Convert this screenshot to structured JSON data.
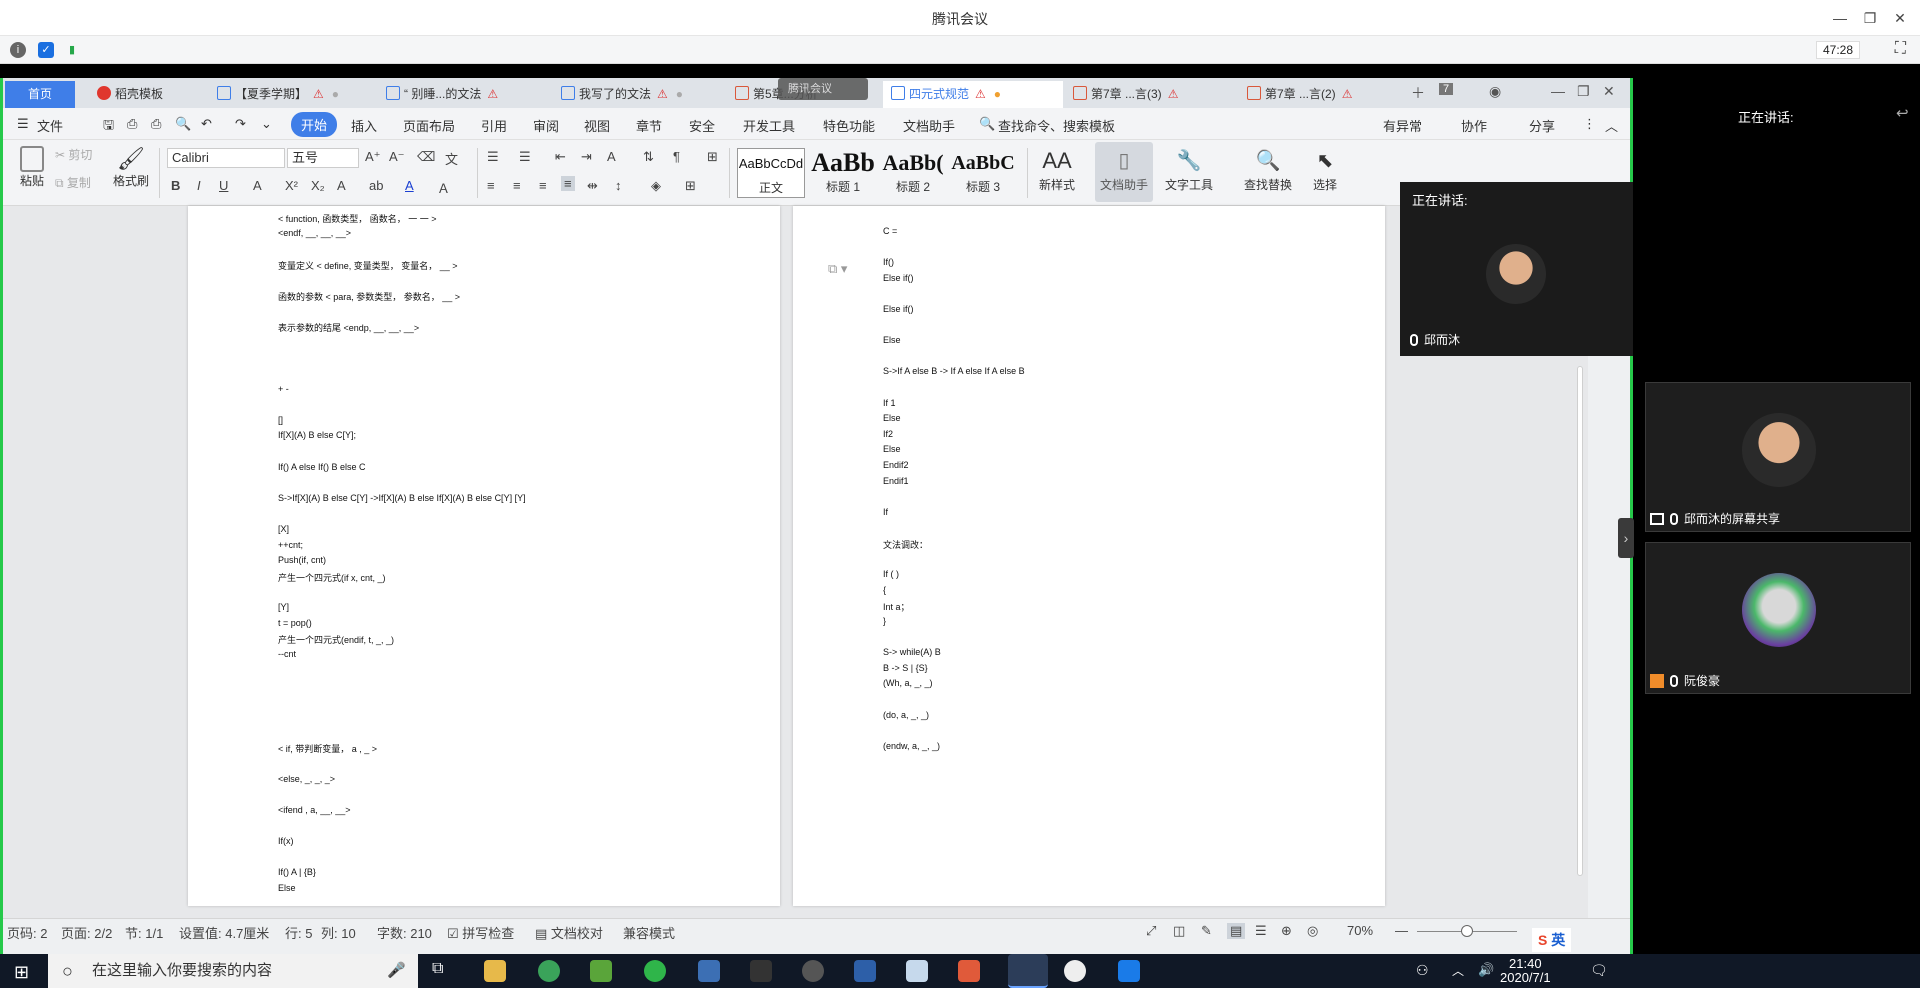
{
  "meeting": {
    "title": "腾讯会议",
    "timer": "47:28",
    "speaking_label": "正在讲话:",
    "speaking_label_small": "正在讲话:"
  },
  "wps": {
    "tabs": [
      {
        "label": "首页",
        "kind": "home"
      },
      {
        "label": "稻壳模板",
        "kind": "r"
      },
      {
        "label": "【夏季学期】",
        "kind": "w",
        "warn": true,
        "dot": true
      },
      {
        "label": "“ 别睡...的文法",
        "kind": "w",
        "warn": true
      },
      {
        "label": "我写了的文法",
        "kind": "w",
        "warn": true,
        "dot": true
      },
      {
        "label": "第5章...分析",
        "kind": "p"
      },
      {
        "label": "四元式规范",
        "kind": "w",
        "warn": true,
        "dot": true,
        "active": true
      },
      {
        "label": "第7章 ...言(3)",
        "kind": "p",
        "warn": true
      },
      {
        "label": "第7章 ...言(2)",
        "kind": "p",
        "warn": true
      }
    ],
    "tab_count": "7",
    "tencent_float": "腾讯会议",
    "menu": {
      "file": "文件",
      "items": [
        "开始",
        "插入",
        "页面布局",
        "引用",
        "审阅",
        "视图",
        "章节",
        "安全",
        "开发工具",
        "特色功能",
        "文档助手"
      ],
      "search": "查找命令、搜索模板",
      "anomaly": "有异常",
      "collab": "协作",
      "share": "分享"
    },
    "ribbon": {
      "paste": "粘贴",
      "cut": "剪切",
      "copy": "复制",
      "format_brush": "格式刷",
      "font": "Calibri",
      "size": "五号",
      "styles": [
        {
          "preview": "AaBbCcDd",
          "label": "正文"
        },
        {
          "preview": "AaBb",
          "label": "标题 1"
        },
        {
          "preview": "AaBb(",
          "label": "标题 2"
        },
        {
          "preview": "AaBbC",
          "label": "标题 3"
        }
      ],
      "new_style": "新样式",
      "doc_assistant": "文档助手",
      "text_tools": "文字工具",
      "find_replace": "查找替换",
      "select": "选择"
    },
    "page1_lines": [
      "< function, 函数类型，   函数名，   一 一    >",
      "<endf, __, __, __>",
      "",
      "变量定义    < define, 变量类型，   变量名，   __ >",
      "",
      "函数的参数    < para, 参数类型，   参数名，   __ >",
      "",
      "表示参数的结尾  <endp, __, __, __>",
      "",
      "",
      "",
      "+ -",
      "",
      "[]",
      "If[X](A) B else C[Y];",
      "",
      "If() A else If() B else C",
      "",
      "S->If[X](A) B else C[Y] ->If[X](A) B else If[X](A) B else C[Y]    [Y]",
      "",
      "[X]",
      "++cnt;",
      "Push(if, cnt)",
      "产生一个四元式(if x, cnt, _)",
      "",
      "[Y]",
      "t = pop()",
      "产生一个四元式(endif, t, _, _)",
      "--cnt",
      "",
      "",
      "",
      "",
      "",
      "< if,   带判断变量，   a , _ >",
      "",
      "<else, _, _, _>",
      "",
      "<ifend , a, __, __>",
      "",
      "If(x)",
      "",
      "If() A | {B}",
      "Else"
    ],
    "page2_lines": [
      "C =",
      "",
      "If()",
      "Else if()",
      "",
      "Else if()",
      "",
      "Else",
      "",
      "S->If A else B -> If A else If A else B",
      "",
      "If 1",
      "Else",
      "If2",
      "Else",
      "Endif2",
      "Endif1",
      "",
      "If",
      "",
      "文法调改：",
      "",
      "If ( )",
      "{",
      "Int a；",
      "}",
      "",
      "S-> while(A) B",
      "B -> S | {S}",
      "(Wh, a, _, _)",
      "",
      "(do, a, _, _)",
      "",
      "(endw, a, _, _)"
    ],
    "status": {
      "page_code": "页码: 2",
      "pages": "页面: 2/2",
      "section": "节: 1/1",
      "setting": "设置值: 4.7厘米",
      "row": "行: 5",
      "col": "列: 10",
      "words": "字数: 210",
      "spell": "拼写检查",
      "proof": "文档校对",
      "compat": "兼容模式",
      "zoom": "70%"
    }
  },
  "participants": {
    "main_speaker": "邱而沐",
    "share_label": "邱而沐的屏幕共享",
    "other": "阮俊豪"
  },
  "taskbar": {
    "search_placeholder": "在这里输入你要搜索的内容",
    "time": "21:40",
    "date": "2020/7/1",
    "ime": "英"
  },
  "colors": {
    "wps_blue": "#3f7ee8",
    "share_border": "#26c94a",
    "warn": "#dd3333"
  }
}
